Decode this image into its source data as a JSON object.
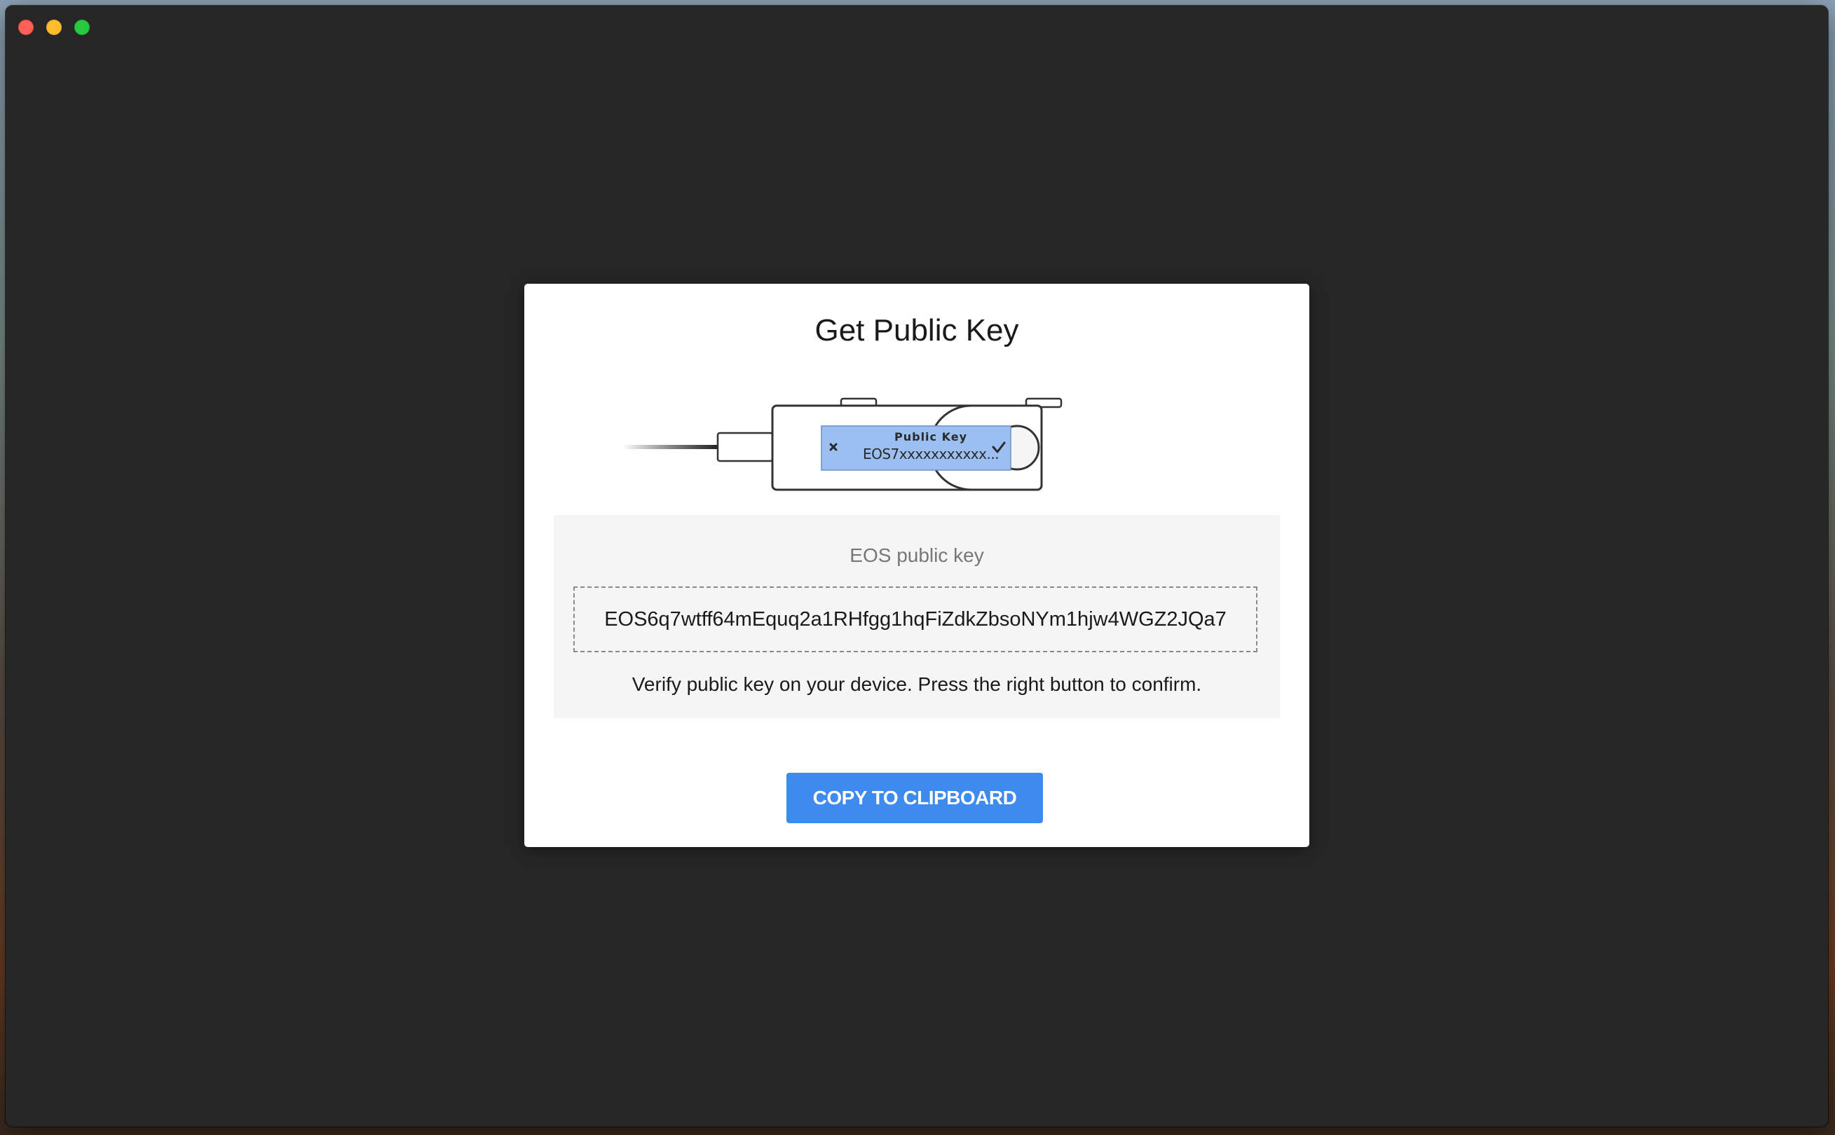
{
  "window": {
    "controls": {
      "close_icon": "close-icon",
      "minimize_icon": "minimize-icon",
      "maximize_icon": "maximize-icon"
    }
  },
  "modal": {
    "title": "Get Public Key",
    "device": {
      "screen_title": "Public Key",
      "screen_value": "EOS7xxxxxxxxxxx...",
      "screen_color": "#9bbff0",
      "reject_icon": "cross-icon",
      "confirm_icon": "checkmark-icon"
    },
    "key_label": "EOS public key",
    "public_key": "EOS6q7wtff64mEquq2a1RHfgg1hqFiZdkZbsoNYm1hjw4WGZ2JQa7",
    "verify_text": "Verify public key on your device. Press the right button to confirm.",
    "copy_button_label": "COPY TO CLIPBOARD"
  },
  "colors": {
    "window_bg": "#262626",
    "modal_bg": "#ffffff",
    "panel_bg": "#f5f5f5",
    "accent": "#3d8bef"
  }
}
